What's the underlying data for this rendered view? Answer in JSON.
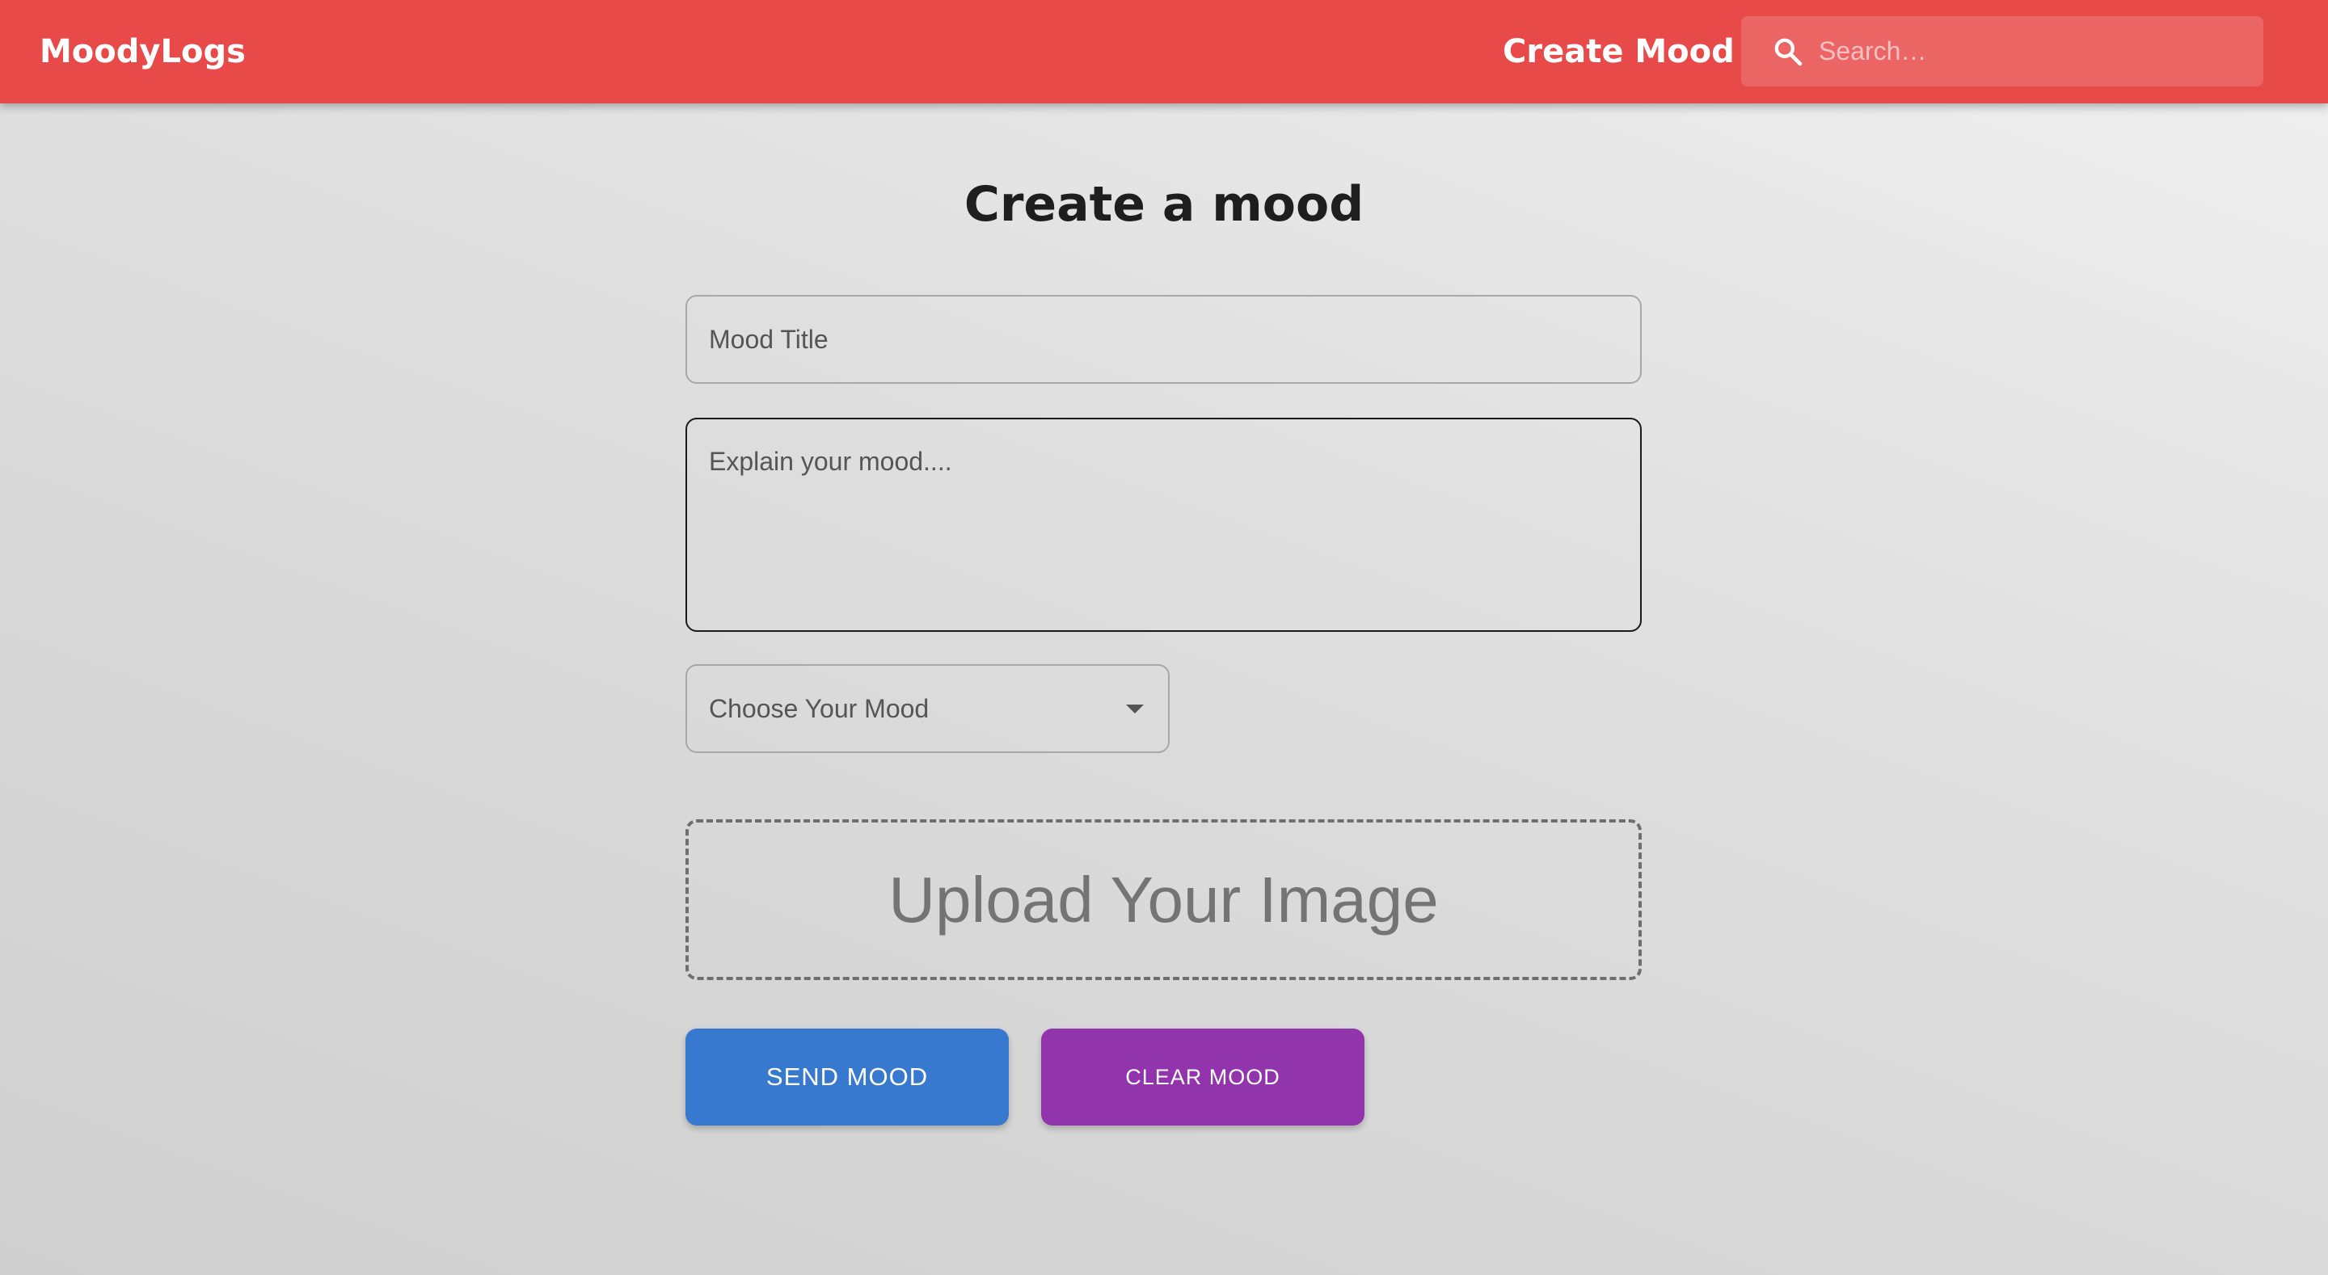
{
  "app": {
    "brand": "MoodyLogs",
    "nav_link": "Create Mood",
    "search": {
      "placeholder": "Search…",
      "value": "",
      "icon": "search-icon"
    },
    "accent_color": "#e84a4a"
  },
  "form": {
    "heading": "Create a mood",
    "title_field": {
      "placeholder": "Mood Title",
      "value": ""
    },
    "description_field": {
      "placeholder": "Explain your mood....",
      "value": ""
    },
    "mood_select": {
      "label": "Choose Your Mood",
      "icon": "caret-down-icon"
    },
    "upload": {
      "label": "Upload Your Image"
    },
    "buttons": {
      "send": {
        "label": "SEND MOOD",
        "color": "#3779cf"
      },
      "clear": {
        "label": "CLEAR MOOD",
        "color": "#9235ad"
      }
    }
  }
}
